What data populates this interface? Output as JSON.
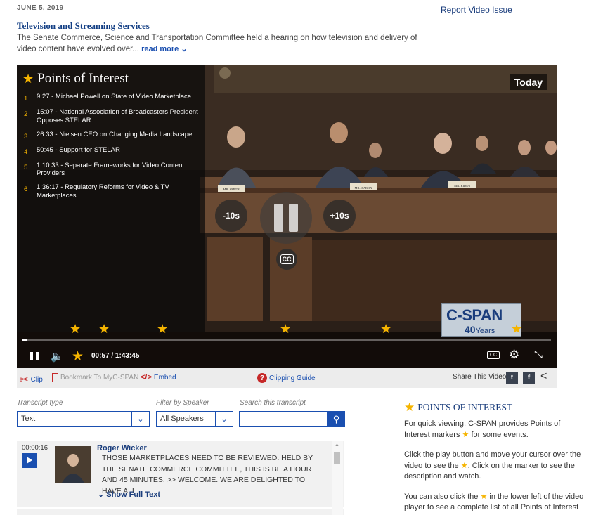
{
  "header": {
    "date": "JUNE 5, 2019",
    "report_link": "Report Video Issue",
    "title": "Television and Streaming Services",
    "description": "The Senate Commerce, Science and Transportation Committee held a hearing on how television and delivery of video content have evolved over...",
    "read_more": "read more"
  },
  "player": {
    "poi_title": "Points of Interest",
    "poi_items": [
      {
        "num": "1",
        "label": "9:27 - Michael Powell on State of Video Marketplace"
      },
      {
        "num": "2",
        "label": "15:07 - National Association of Broadcasters President Opposes STELAR"
      },
      {
        "num": "3",
        "label": "26:33 - Nielsen CEO on Changing Media Landscape"
      },
      {
        "num": "4",
        "label": "50:45 - Support for STELAR"
      },
      {
        "num": "5",
        "label": "1:10:33 - Separate Frameworks for Video Content Providers"
      },
      {
        "num": "6",
        "label": "1:36:17 - Regulatory Reforms for Video & TV Marketplaces"
      }
    ],
    "badge": "Today",
    "skip_back": "-10s",
    "skip_forward": "+10s",
    "cc": "CC",
    "logo_line1": "C-SPAN",
    "logo_num": "40",
    "logo_years": "Years",
    "current_time": "00:57",
    "total_time": "1:43:45",
    "time_separator": "/",
    "progress_fraction": 0.009,
    "nameplates": [
      "MR. SMITH",
      "MR. AARON",
      "MR. RIDDY"
    ],
    "accent_color": "#f5b400"
  },
  "toolbar": {
    "clip": "Clip",
    "bookmark": "Bookmark To MyC-SPAN",
    "embed": "Embed",
    "embed_icon": "</>",
    "clipping_guide": "Clipping Guide",
    "share": "Share This Video"
  },
  "transcript": {
    "type_label": "Transcript type",
    "type_value": "Text",
    "speaker_label": "Filter by Speaker",
    "speaker_value": "All Speakers",
    "search_label": "Search this transcript",
    "search_placeholder": "",
    "entry": {
      "timestamp": "00:00:16",
      "speaker": "Roger Wicker",
      "text": "THOSE MARKETPLACES NEED TO BE REVIEWED. HELD BY THE SENATE COMMERCE COMMITTEE, THIS IS BE A HOUR AND 45 MINUTES. >> WELCOME. WE ARE DELIGHTED TO HAVE ALL...",
      "show_full": "Show Full Text"
    }
  },
  "sidebar": {
    "heading": "POINTS OF INTEREST",
    "p1a": "For quick viewing, C-SPAN provides Points of Interest markers",
    "p1b": "for some events.",
    "p2a": "Click the play button and move your cursor over the video to see the",
    "p2b": ". Click on the marker to see the description and watch.",
    "p3a": "You can also click the",
    "p3b": "in the lower left of the video player to see a complete list of all Points of Interest"
  }
}
